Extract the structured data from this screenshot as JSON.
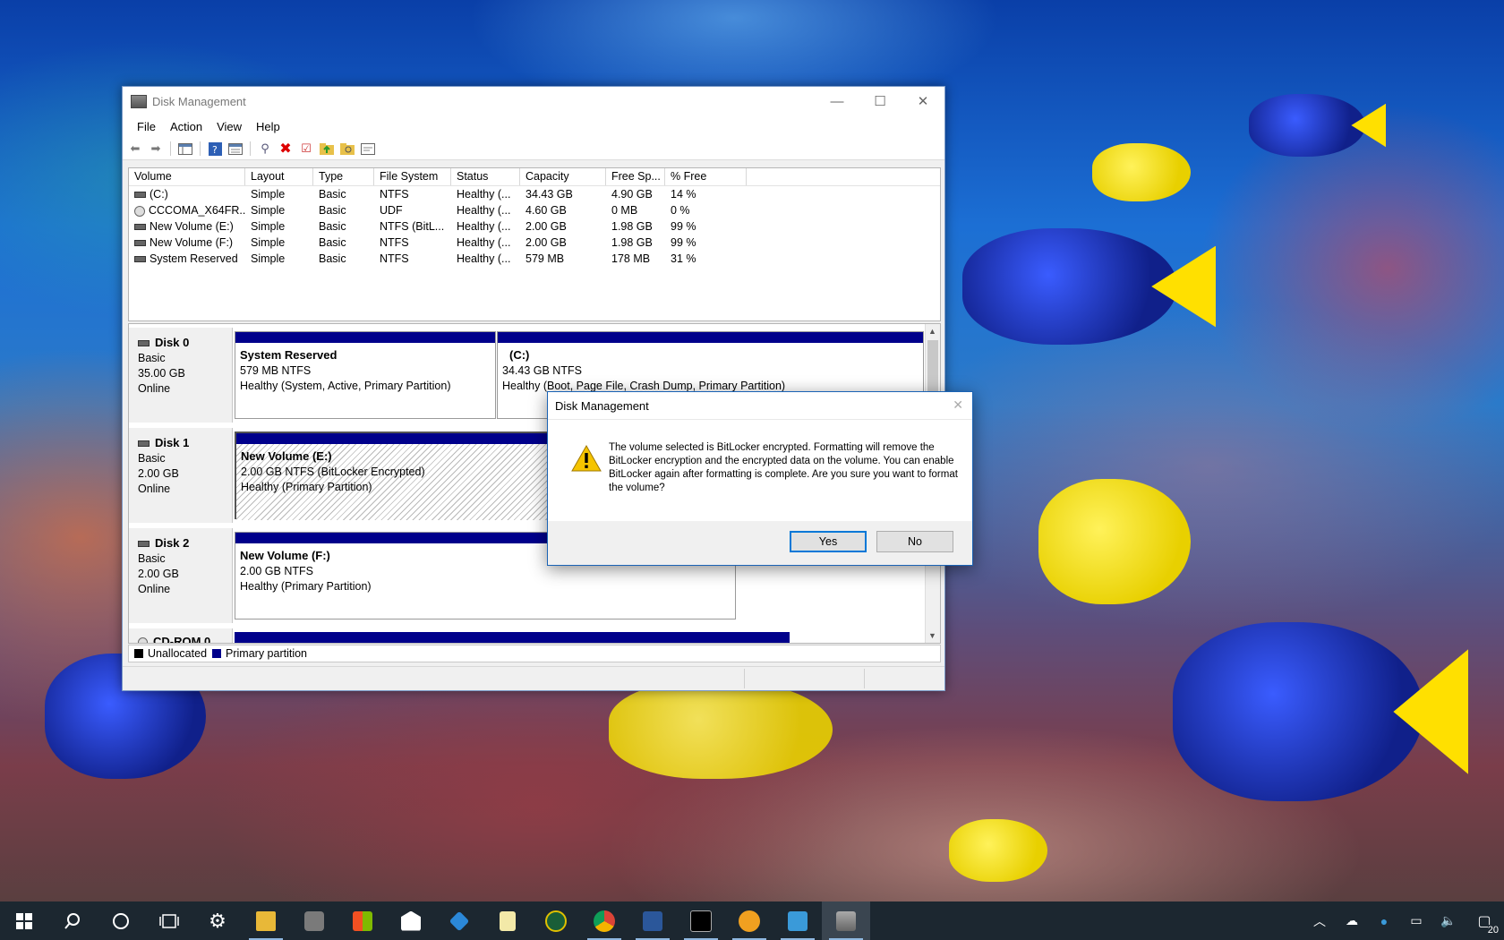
{
  "window": {
    "title": "Disk Management",
    "controls": {
      "minimize": "—",
      "maximize": "☐",
      "close": "✕"
    },
    "menu": [
      "File",
      "Action",
      "View",
      "Help"
    ]
  },
  "volume_list": {
    "columns": [
      "Volume",
      "Layout",
      "Type",
      "File System",
      "Status",
      "Capacity",
      "Free Sp...",
      "% Free"
    ],
    "rows": [
      [
        "(C:)",
        "Simple",
        "Basic",
        "NTFS",
        "Healthy (...",
        "34.43 GB",
        "4.90 GB",
        "14 %"
      ],
      [
        "CCCOMA_X64FR...",
        "Simple",
        "Basic",
        "UDF",
        "Healthy (...",
        "4.60 GB",
        "0 MB",
        "0 %"
      ],
      [
        "New Volume (E:)",
        "Simple",
        "Basic",
        "NTFS (BitL...",
        "Healthy (...",
        "2.00 GB",
        "1.98 GB",
        "99 %"
      ],
      [
        "New Volume (F:)",
        "Simple",
        "Basic",
        "NTFS",
        "Healthy (...",
        "2.00 GB",
        "1.98 GB",
        "99 %"
      ],
      [
        "System Reserved",
        "Simple",
        "Basic",
        "NTFS",
        "Healthy (...",
        "579 MB",
        "178 MB",
        "31 %"
      ]
    ]
  },
  "disks": [
    {
      "name": "Disk 0",
      "type": "Basic",
      "size": "35.00 GB",
      "state": "Online",
      "partitions": [
        {
          "name": "System Reserved",
          "detail": "579 MB NTFS",
          "status": "Healthy (System, Active, Primary Partition)"
        },
        {
          "name": "(C:)",
          "detail": "34.43 GB NTFS",
          "status": "Healthy (Boot, Page File, Crash Dump, Primary Partition)"
        }
      ]
    },
    {
      "name": "Disk 1",
      "type": "Basic",
      "size": "2.00 GB",
      "state": "Online",
      "partitions": [
        {
          "name": "New Volume  (E:)",
          "detail": "2.00 GB NTFS (BitLocker Encrypted)",
          "status": "Healthy (Primary Partition)"
        }
      ]
    },
    {
      "name": "Disk 2",
      "type": "Basic",
      "size": "2.00 GB",
      "state": "Online",
      "partitions": [
        {
          "name": "New Volume  (F:)",
          "detail": "2.00 GB NTFS",
          "status": "Healthy (Primary Partition)"
        }
      ]
    },
    {
      "name": "CD-ROM 0"
    }
  ],
  "legend": {
    "unallocated": "Unallocated",
    "primary": "Primary partition",
    "unallocated_color": "#000000",
    "primary_color": "#00008b"
  },
  "dialog": {
    "title": "Disk Management",
    "message": "The volume selected is BitLocker encrypted. Formatting will remove the BitLocker encryption and the encrypted data on the volume. You can enable BitLocker again after formatting is complete. Are you sure you want to format the volume?",
    "yes": "Yes",
    "no": "No",
    "close": "✕"
  },
  "taskbar": {
    "icons": [
      "windows-start-icon",
      "search-icon",
      "cortana-icon",
      "task-view-icon",
      "settings-icon",
      "file-explorer-icon",
      "camera-icon",
      "store-icon",
      "mail-icon",
      "app-icon",
      "notepad-icon",
      "app-icon",
      "chrome-icon",
      "word-icon",
      "terminal-icon",
      "app-icon",
      "app-icon",
      "disk-management-icon"
    ],
    "notification_count": "20"
  }
}
